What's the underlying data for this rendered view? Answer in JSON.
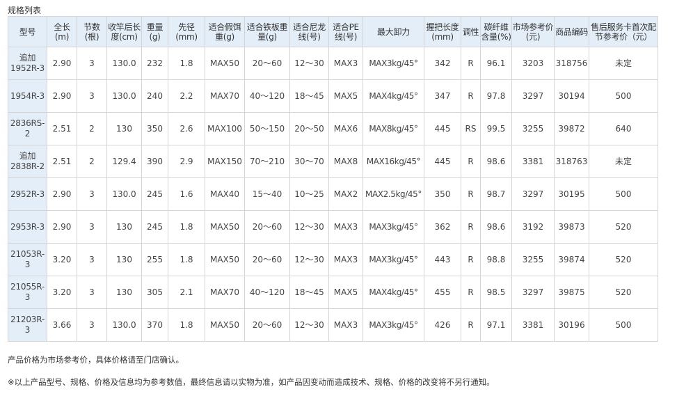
{
  "title": "规格列表",
  "table": {
    "headers": [
      "型号",
      "全长(m)",
      "节数(根)",
      "收竿后长度(cm)",
      "重量(g)",
      "先径(mm)",
      "适合假饵重(g)",
      "适合铁板重量(g)",
      "适合尼龙线(号)",
      "适合PE线(号)",
      "最大卸力",
      "握把长度(mm)",
      "调性",
      "碳纤维含量(%)",
      "市场参考价(元)",
      "商品编码",
      "售后服务卡首次配节参考价（元）"
    ],
    "rows": [
      [
        "追加1952R-3",
        "2.90",
        "3",
        "130.0",
        "232",
        "1.8",
        "MAX50",
        "20～60",
        "12～30",
        "MAX3",
        "MAX3kg/45°",
        "342",
        "R",
        "96.1",
        "3203",
        "318756",
        "未定"
      ],
      [
        "1954R-3",
        "2.90",
        "3",
        "130.0",
        "240",
        "2.2",
        "MAX70",
        "40～120",
        "18～45",
        "MAX5",
        "MAX4kg/45°",
        "347",
        "R",
        "97.8",
        "3297",
        "30194",
        "500"
      ],
      [
        "2836RS-2",
        "2.51",
        "2",
        "130",
        "350",
        "2.6",
        "MAX100",
        "50～150",
        "20～50",
        "MAX6",
        "MAX8kg/45°",
        "445",
        "RS",
        "99.5",
        "3255",
        "39872",
        "640"
      ],
      [
        "追加2838R-2",
        "2.51",
        "2",
        "129.4",
        "390",
        "2.9",
        "MAX150",
        "70～210",
        "30～70",
        "MAX8",
        "MAX16kg/45°",
        "445",
        "R",
        "98.6",
        "3381",
        "318763",
        "未定"
      ],
      [
        "2952R-3",
        "2.90",
        "3",
        "130.0",
        "245",
        "1.6",
        "MAX40",
        "15～40",
        "10～25",
        "MAX2",
        "MAX2.5kg/45°",
        "350",
        "R",
        "98.7",
        "3297",
        "30195",
        "500"
      ],
      [
        "2953R-3",
        "2.90",
        "3",
        "130",
        "245",
        "1.8",
        "MAX50",
        "20～60",
        "12～30",
        "MAX3",
        "MAX3kg/45°",
        "362",
        "R",
        "98.6",
        "3192",
        "39873",
        "520"
      ],
      [
        "21053R-3",
        "3.20",
        "3",
        "130",
        "255",
        "1.8",
        "MAX50",
        "20～60",
        "12～30",
        "MAX3",
        "MAX3kg/45°",
        "443",
        "R",
        "98.8",
        "3255",
        "39874",
        "520"
      ],
      [
        "21055R-3",
        "3.20",
        "3",
        "130",
        "305",
        "2.1",
        "MAX70",
        "40～120",
        "18～45",
        "MAX5",
        "MAX4kg/45°",
        "455",
        "R",
        "98.5",
        "3297",
        "39875",
        "520"
      ],
      [
        "21203R-3",
        "3.66",
        "3",
        "130.0",
        "370",
        "1.8",
        "MAX50",
        "20～60",
        "12～30",
        "MAX3",
        "MAX3kg/45°",
        "426",
        "R",
        "97.1",
        "3381",
        "30196",
        "500"
      ]
    ]
  },
  "notes": [
    "产品价格为市场参考价，具体价格请至门店确认。",
    "※以上产品型号、规格、价格及信息均为参考数值，最终信息请以实物为准，如产品因变动而造成技术、规格、价格的改变将不另行通知。"
  ]
}
